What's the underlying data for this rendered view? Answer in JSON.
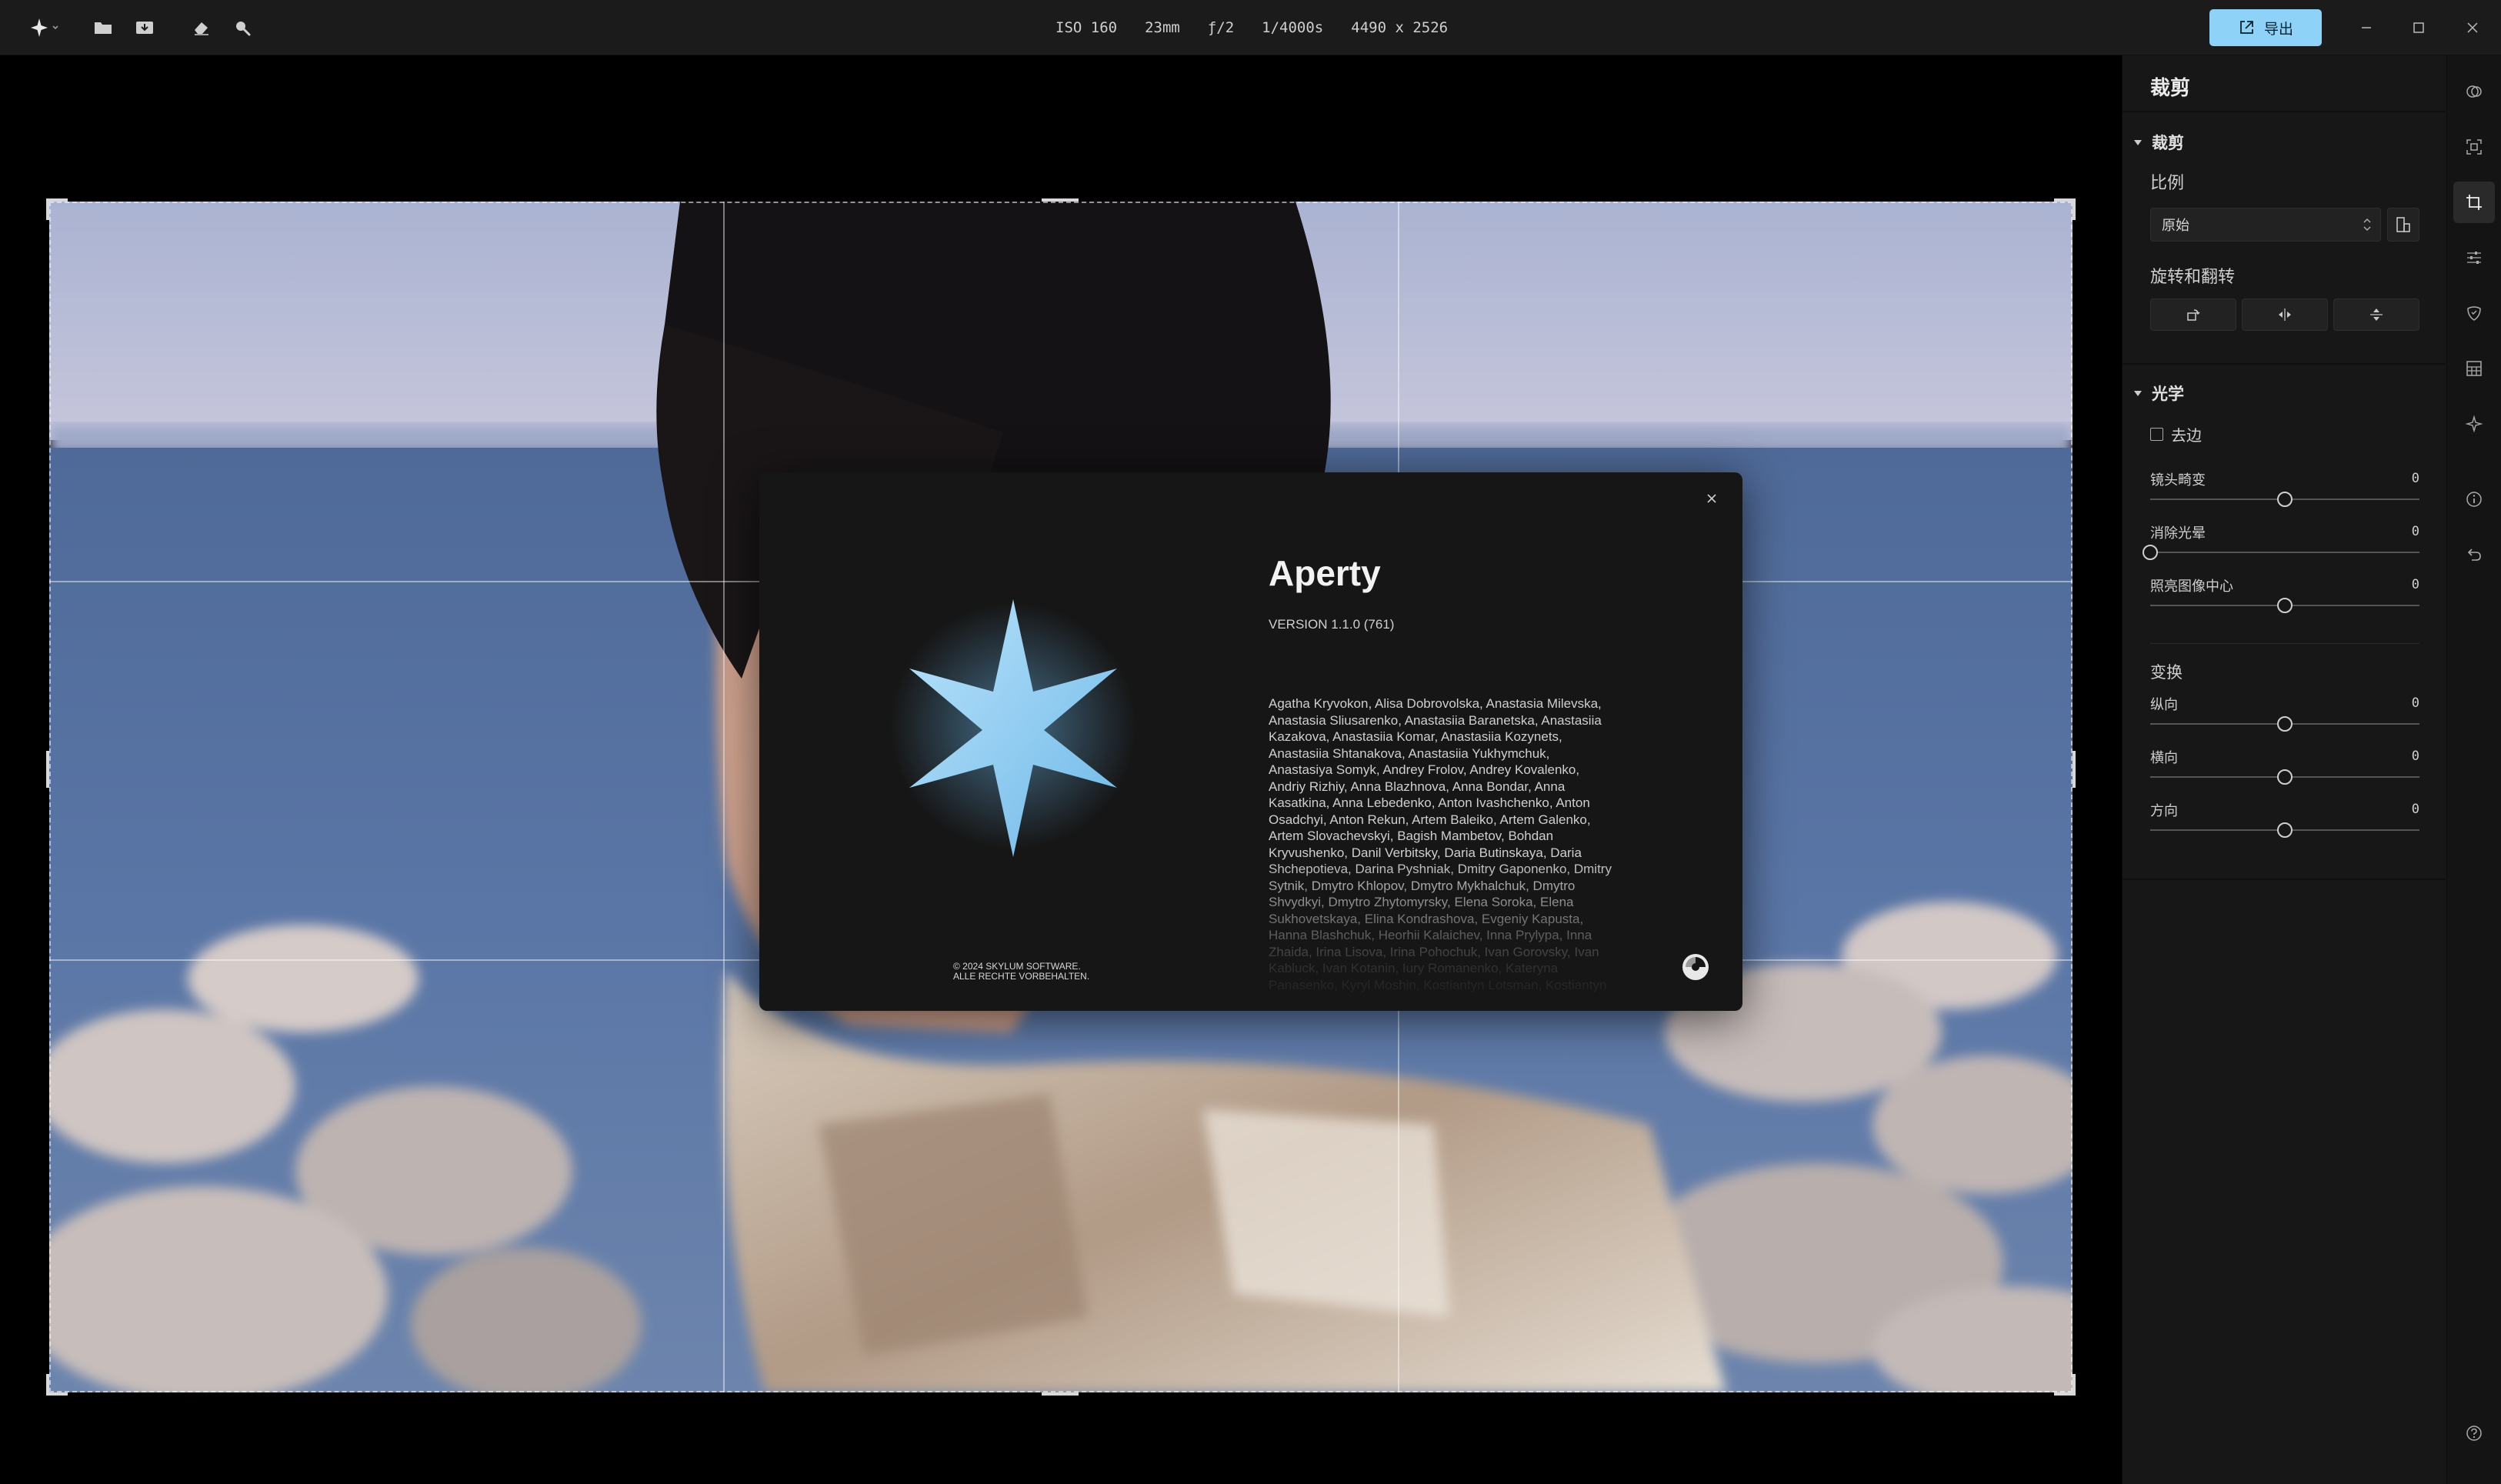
{
  "titlebar": {
    "exif": {
      "iso": "ISO 160",
      "focal": "23mm",
      "aperture": "ƒ/2",
      "shutter": "1/4000s",
      "dimensions": "4490 x 2526"
    },
    "export_label": "导出",
    "accent": "#8fd2f7"
  },
  "about": {
    "title": "Aperty",
    "version": "VERSION 1.1.0 (761)",
    "credits": "Agatha Kryvokon, Alisa Dobrovolska, Anastasia Milevska, Anastasia Sliusarenko, Anastasiia Baranetska, Anastasiia Kazakova, Anastasiia Komar, Anastasiia Kozynets, Anastasiia Shtanakova, Anastasiia Yukhymchuk, Anastasiya Somyk, Andrey Frolov, Andrey Kovalenko, Andriy Rizhiy, Anna Blazhnova, Anna Bondar, Anna Kasatkina, Anna Lebedenko, Anton Ivashchenko, Anton Osadchyi, Anton Rekun, Artem Baleiko, Artem Galenko, Artem Slovachevskyi, Bagish Mambetov, Bohdan Kryvushenko, Danil Verbitsky, Daria Butinskaya, Daria Shchepotieva, Darina Pyshniak, Dmitry Gaponenko, Dmitry Sytnik, Dmytro Khlopov, Dmytro Mykhalchuk, Dmytro Shvydkyi, Dmytro Zhytomyrsky, Elena Soroka, Elena Sukhovetskaya, Elina Kondrashova, Evgeniy Kapusta, Hanna Blashchuk, Heorhii Kalaichev, Inna Prylypa, Inna Zhaida, Irina Lisova, Irina Pohochuk, Ivan Gorovsky, Ivan Kabluck, Ivan Kotanin, Iury Romanenko, Kateryna Panasenko, Kyryl Moshin, Kostiantyn Lotsman, Kostiantyn",
    "copyright_line1": "© 2024 SKYLUM SOFTWARE.",
    "copyright_line2": "ALLE RECHTE VORBEHALTEN.",
    "star_color": "#8ccff2"
  },
  "panel": {
    "title": "裁剪",
    "crop": {
      "section": "裁剪",
      "ratio_label": "比例",
      "ratio_value": "原始",
      "rotate_label": "旋转和翻转"
    },
    "optics": {
      "section": "光学",
      "checkbox_label": "去边",
      "sliders": [
        {
          "label": "镜头畸变",
          "value": "0",
          "position": 0.5
        },
        {
          "label": "消除光晕",
          "value": "0",
          "position": 0.0
        },
        {
          "label": "照亮图像中心",
          "value": "0",
          "position": 0.5
        }
      ]
    },
    "transform": {
      "section": "变换",
      "sliders": [
        {
          "label": "纵向",
          "value": "0",
          "position": 0.5
        },
        {
          "label": "横向",
          "value": "0",
          "position": 0.5
        },
        {
          "label": "方向",
          "value": "0",
          "position": 0.5
        }
      ]
    }
  }
}
